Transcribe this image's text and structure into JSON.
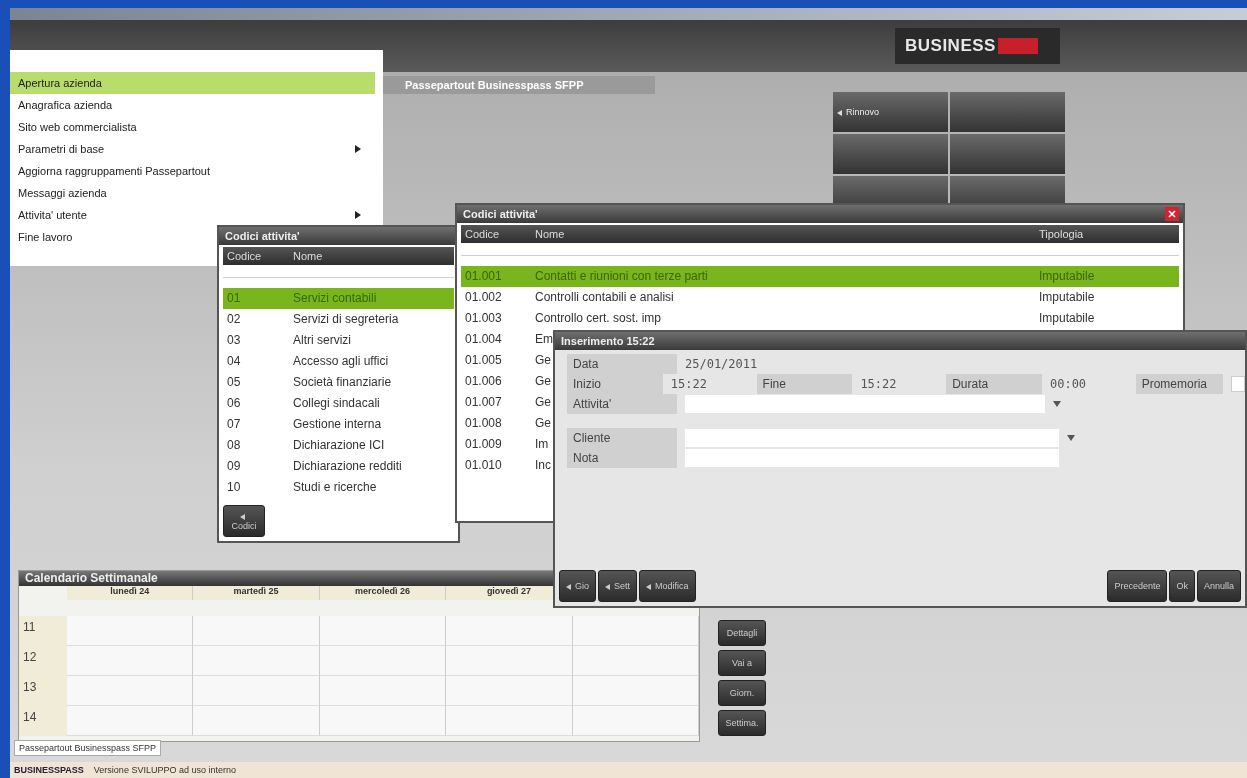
{
  "app_tab": {
    "label": "Passepartout Businesspass SFPP"
  },
  "logo": {
    "text": "BUSINESS"
  },
  "menu": {
    "items": [
      {
        "label": "Apertura azienda",
        "selected": true,
        "submenu": false
      },
      {
        "label": "Anagrafica azienda",
        "selected": false,
        "submenu": false
      },
      {
        "label": "Sito web commercialista",
        "selected": false,
        "submenu": false
      },
      {
        "label": "Parametri di base",
        "selected": false,
        "submenu": true
      },
      {
        "label": "Aggiorna raggruppamenti Passepartout",
        "selected": false,
        "submenu": false
      },
      {
        "label": "Messaggi azienda",
        "selected": false,
        "submenu": false
      },
      {
        "label": "Attivita' utente",
        "selected": false,
        "submenu": true
      },
      {
        "label": "Fine lavoro",
        "selected": false,
        "submenu": false
      }
    ]
  },
  "tiles": [
    {
      "label": "Rinnovo"
    }
  ],
  "groups_window": {
    "title": "Codici attivita'",
    "columns": [
      "Codice",
      "Nome"
    ],
    "rows": [
      {
        "code": "01",
        "name": "Servizi contabili",
        "selected": true
      },
      {
        "code": "02",
        "name": "Servizi di segreteria",
        "selected": false
      },
      {
        "code": "03",
        "name": "Altri servizi",
        "selected": false
      },
      {
        "code": "04",
        "name": "Accesso agli uffici",
        "selected": false
      },
      {
        "code": "05",
        "name": "Società finanziarie",
        "selected": false
      },
      {
        "code": "06",
        "name": "Collegi sindacali",
        "selected": false
      },
      {
        "code": "07",
        "name": "Gestione interna",
        "selected": false
      },
      {
        "code": "08",
        "name": "Dichiarazione ICI",
        "selected": false
      },
      {
        "code": "09",
        "name": "Dichiarazione redditi",
        "selected": false
      },
      {
        "code": "10",
        "name": "Studi e ricerche",
        "selected": false
      }
    ],
    "button": "Codici"
  },
  "codes_window": {
    "title": "Codici attivita'",
    "columns": [
      "Codice",
      "Nome",
      "Tipologia"
    ],
    "rows": [
      {
        "code": "01.001",
        "name": "Contatti e riunioni con terze parti",
        "type": "Imputabile",
        "selected": true
      },
      {
        "code": "01.002",
        "name": "Controlli contabili e analisi",
        "type": "Imputabile",
        "selected": false
      },
      {
        "code": "01.003",
        "name": "Controllo cert. sost. imp",
        "type": "Imputabile",
        "selected": false
      },
      {
        "code": "01.004",
        "name": "Em",
        "type": "",
        "selected": false
      },
      {
        "code": "01.005",
        "name": "Ge",
        "type": "",
        "selected": false
      },
      {
        "code": "01.006",
        "name": "Ge",
        "type": "",
        "selected": false
      },
      {
        "code": "01.007",
        "name": "Ge",
        "type": "",
        "selected": false
      },
      {
        "code": "01.008",
        "name": "Ge",
        "type": "",
        "selected": false
      },
      {
        "code": "01.009",
        "name": "Im",
        "type": "",
        "selected": false
      },
      {
        "code": "01.010",
        "name": "Inc",
        "type": "",
        "selected": false
      }
    ]
  },
  "entry_window": {
    "title": "Inserimento 15:22",
    "date_label": "Data",
    "date": "25/01/2011",
    "start_label": "Inizio",
    "start": "15:22",
    "end_label": "Fine",
    "end": "15:22",
    "duration_label": "Durata",
    "duration": "00:00",
    "reminder_label": "Promemoria",
    "reminder_checked": false,
    "activity_label": "Attivita'",
    "client_label": "Cliente",
    "note_label": "Nota",
    "left_buttons": [
      "Gio",
      "Sett",
      "Modifica"
    ],
    "right_buttons": [
      "Precedente",
      "Ok",
      "Annulla"
    ]
  },
  "calendar": {
    "title": "Calendario Settimanale",
    "days": [
      "lunedì 24",
      "martedì 25",
      "mercoledì 26",
      "giovedì 27"
    ],
    "hours": [
      "11",
      "12",
      "13",
      "14"
    ],
    "buttons": [
      "Dettagli",
      "Vai a",
      "Giorn.",
      "Settima."
    ]
  },
  "bottom_tab": {
    "label": "Passepartout Businesspass SFPP"
  },
  "status_bar": {
    "brand": "BUSINESSPASS",
    "text": "Versione SVILUPPO ad uso interno"
  }
}
